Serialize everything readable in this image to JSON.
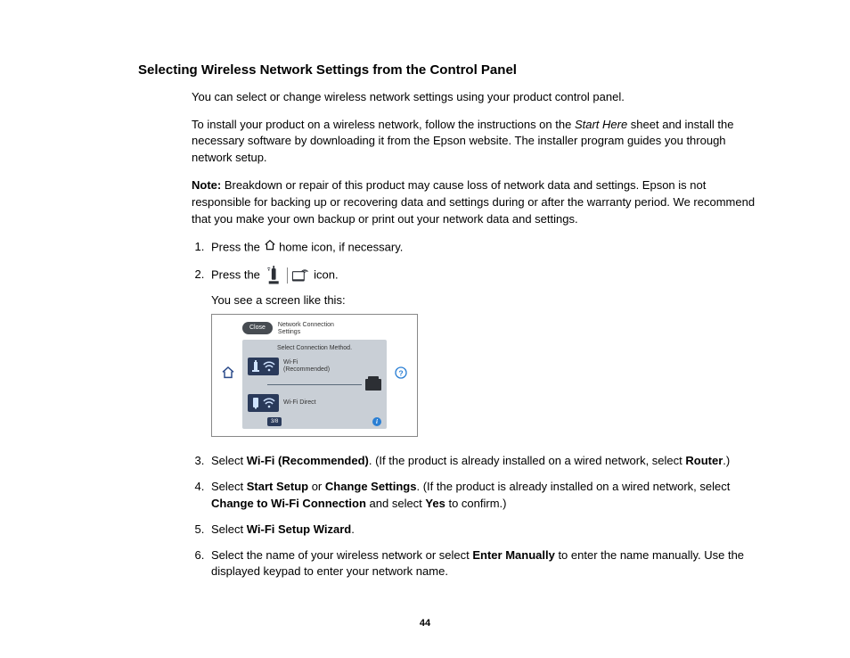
{
  "heading": "Selecting Wireless Network Settings from the Control Panel",
  "para1": "You can select or change wireless network settings using your product control panel.",
  "para2_a": "To install your product on a wireless network, follow the instructions on the ",
  "para2_em": "Start Here",
  "para2_b": " sheet and install the necessary software by downloading it from the Epson website. The installer program guides you through network setup.",
  "note_label": "Note:",
  "note_body": " Breakdown or repair of this product may cause loss of network data and settings. Epson is not responsible for backing up or recovering data and settings during or after the warranty period. We recommend that you make your own backup or print out your network data and settings.",
  "step1_a": "Press the ",
  "step1_b": " home icon, if necessary.",
  "step2_a": "Press the ",
  "step2_b": " icon.",
  "step2_sub": "You see a screen like this:",
  "figure": {
    "close": "Close",
    "title_line1": "Network Connection",
    "title_line2": "Settings",
    "subhead": "Select Connection Method.",
    "option1_line1": "Wi-Fi",
    "option1_line2": "(Recommended)",
    "option2": "Wi-Fi Direct",
    "pager": "3/8",
    "info": "i"
  },
  "step3_a": "Select ",
  "step3_b1": "Wi-Fi (Recommended)",
  "step3_c": ". (If the product is already installed on a wired network, select ",
  "step3_b2": "Router",
  "step3_d": ".)",
  "step4_a": "Select ",
  "step4_b1": "Start Setup",
  "step4_or": " or ",
  "step4_b2": "Change Settings",
  "step4_c": ". (If the product is already installed on a wired network, select ",
  "step4_b3": "Change to Wi-Fi Connection",
  "step4_d": " and select ",
  "step4_b4": "Yes",
  "step4_e": " to confirm.)",
  "step5_a": "Select ",
  "step5_b": "Wi-Fi Setup Wizard",
  "step5_c": ".",
  "step6_a": "Select the name of your wireless network or select ",
  "step6_b": "Enter Manually",
  "step6_c": " to enter the name manually. Use the displayed keypad to enter your network name.",
  "page_number": "44"
}
